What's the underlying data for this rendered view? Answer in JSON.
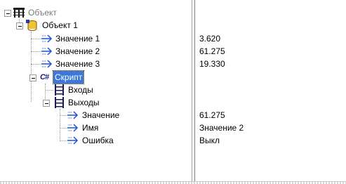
{
  "tree": {
    "root": {
      "label": "Объект",
      "icon": "table-tree-icon"
    },
    "object1": {
      "label": "Объект 1",
      "icon": "cylinder-db-icon"
    },
    "object1_children": [
      {
        "label": "Значение 1",
        "value": "3.620",
        "icon": "arrow-port-icon"
      },
      {
        "label": "Значение 2",
        "value": "61.275",
        "icon": "arrow-port-icon"
      },
      {
        "label": "Значение 3",
        "value": "19.330",
        "icon": "arrow-port-icon"
      }
    ],
    "script": {
      "label": "Скрипт",
      "icon_text": "C#",
      "icon": "csharp-icon"
    },
    "inputs": {
      "label": "Входы",
      "icon": "ladder-icon"
    },
    "outputs": {
      "label": "Выходы",
      "icon": "ladder-icon"
    },
    "output_children": [
      {
        "label": "Значение",
        "value": "61.275",
        "icon": "arrow-port-icon"
      },
      {
        "label": "Имя",
        "value": "Значение 2",
        "icon": "arrow-port-icon"
      },
      {
        "label": "Ошибка",
        "value": "Выкл",
        "icon": "arrow-port-icon"
      }
    ]
  },
  "colors": {
    "selection": "#3b78d8",
    "tree_lines": "#9a9a9a",
    "arrow_icon": "#1e4fd8"
  }
}
